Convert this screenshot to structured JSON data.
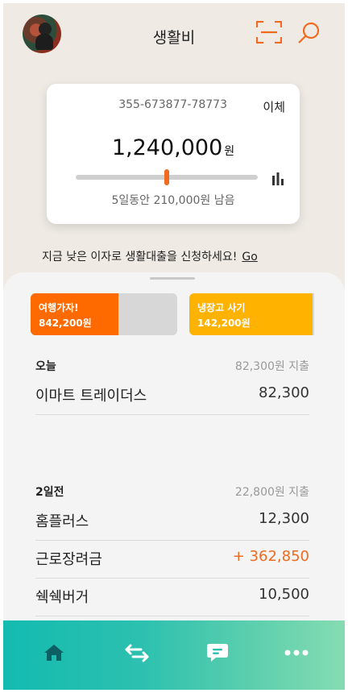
{
  "header": {
    "title": "생활비"
  },
  "card": {
    "account_number": "355-673877-78773",
    "transfer_label": "이체",
    "amount": "1,240,000",
    "unit": "원",
    "spent_fraction": 0.5,
    "remaining_text": "5일동안 210,000원 남음"
  },
  "loan": {
    "text": "지금 낮은 이자로 생활대출을 신청하세요!",
    "link": "Go"
  },
  "goals": [
    {
      "name": "여행가자!",
      "amount": "842,200원",
      "color": "#ff6a00",
      "progress": 0.6
    },
    {
      "name": "냉장고 사기",
      "amount": "142,200원",
      "color": "#ffb300",
      "progress": 0.9
    }
  ],
  "days": [
    {
      "label": "오늘",
      "total": "82,300원 지출",
      "items": [
        {
          "name": "이마트 트레이더스",
          "amount": "82,300"
        }
      ]
    },
    {
      "label": "2일전",
      "total": "22,800원 지출",
      "items": [
        {
          "name": "홈플러스",
          "amount": "12,300"
        },
        {
          "name": "근로장려금",
          "amount": "+ 362,850",
          "income": true
        },
        {
          "name": "쉑쉑버거",
          "amount": "10,500"
        }
      ]
    }
  ],
  "tabbar": {
    "icons": [
      "home-icon",
      "transfer-arrows-icon",
      "chat-icon",
      "more-icon"
    ]
  },
  "colors": {
    "accent": "#f06b1f",
    "tab_start": "#13bbb0",
    "tab_end": "#86dcb2"
  }
}
